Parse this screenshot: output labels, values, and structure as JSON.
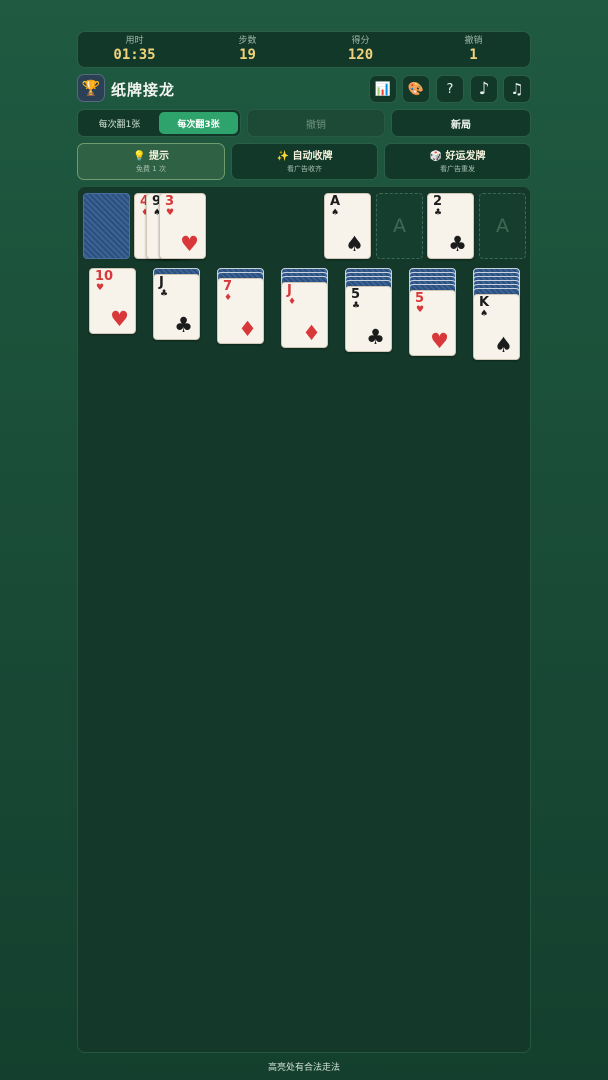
{
  "stats": [
    {
      "label": "用时",
      "value": "01:35"
    },
    {
      "label": "步数",
      "value": "19"
    },
    {
      "label": "得分",
      "value": "120"
    },
    {
      "label": "撤销",
      "value": "1"
    }
  ],
  "header": {
    "title": "纸牌接龙",
    "logo_icon": "🏆",
    "icons": {
      "stats": "📊",
      "theme": "🎨",
      "help": "?",
      "music": "♪",
      "sound": "♫"
    }
  },
  "mode": {
    "draw1": "每次翻1张",
    "draw3": "每次翻3张",
    "active": "draw3"
  },
  "buttons": {
    "undo": "撤销",
    "new_game": "新局"
  },
  "actions": {
    "hint": {
      "icon": "💡",
      "title": "提示",
      "sub": "免费 1 次"
    },
    "auto": {
      "icon": "✨",
      "title": "自动收牌",
      "sub": "看广告收齐"
    },
    "lucky": {
      "icon": "🎲",
      "title": "好运发牌",
      "sub": "看广告重发"
    }
  },
  "waste": [
    {
      "rank": "4",
      "suit": "♦",
      "color": "red"
    },
    {
      "rank": "9",
      "suit": "♠",
      "color": "black"
    },
    {
      "rank": "3",
      "suit": "♥",
      "color": "red"
    }
  ],
  "foundations": [
    {
      "rank": "A",
      "suit": "♠",
      "color": "black",
      "empty": false
    },
    {
      "label": "A",
      "empty": true
    },
    {
      "rank": "2",
      "suit": "♣",
      "color": "black",
      "empty": false
    },
    {
      "label": "A",
      "empty": true
    }
  ],
  "tableau": [
    {
      "hidden": 0,
      "top": {
        "rank": "10",
        "suit": "♥",
        "color": "red"
      }
    },
    {
      "hidden": 1,
      "top": {
        "rank": "J",
        "suit": "♣",
        "color": "black"
      }
    },
    {
      "hidden": 2,
      "top": {
        "rank": "7",
        "suit": "♦",
        "color": "red"
      }
    },
    {
      "hidden": 3,
      "top": {
        "rank": "J",
        "suit": "♦",
        "color": "red"
      }
    },
    {
      "hidden": 4,
      "top": {
        "rank": "5",
        "suit": "♣",
        "color": "black"
      }
    },
    {
      "hidden": 5,
      "top": {
        "rank": "5",
        "suit": "♥",
        "color": "red"
      }
    },
    {
      "hidden": 6,
      "top": {
        "rank": "K",
        "suit": "♠",
        "color": "black"
      }
    }
  ],
  "footer": "高亮处有合法走法"
}
